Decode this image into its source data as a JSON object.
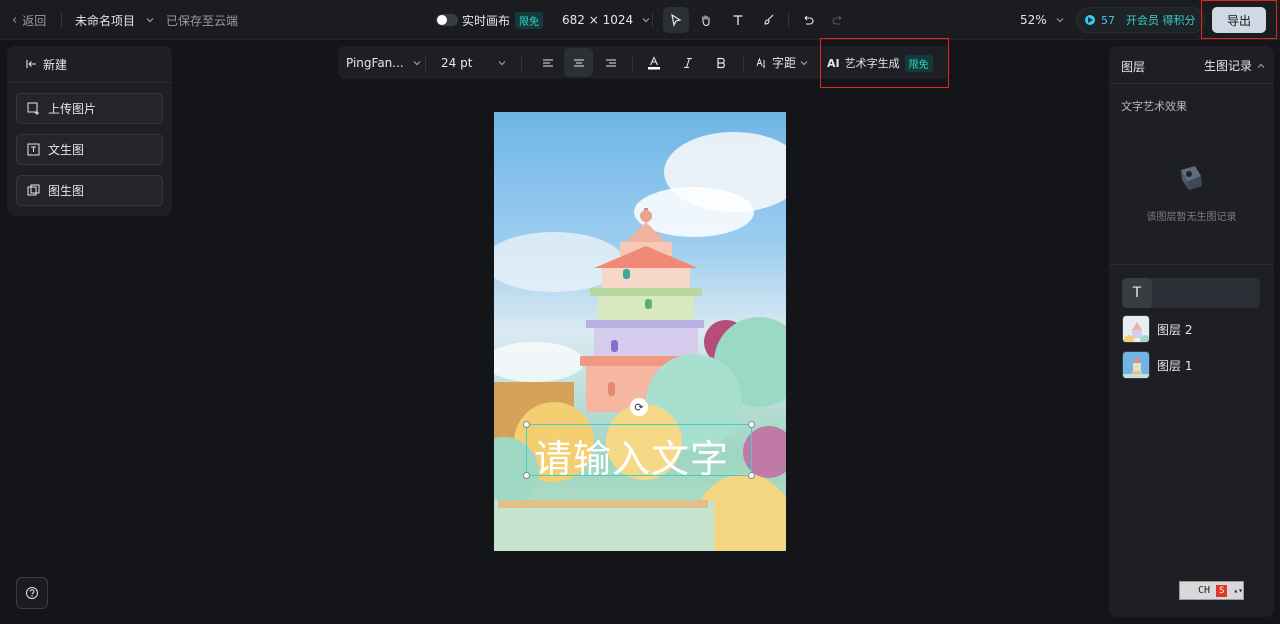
{
  "topbar": {
    "back_label": "返回",
    "project_name": "未命名项目",
    "save_status": "已保存至云端",
    "realtime_label": "实时画布",
    "realtime_badge": "限免",
    "canvas_size": "682 × 1024",
    "zoom": "52%",
    "credits_value": "57",
    "membership_label": "开会员 得积分",
    "export_label": "导出"
  },
  "left_panel": {
    "new_label": "新建",
    "buttons": [
      {
        "label": "上传图片",
        "icon": "upload-image-icon"
      },
      {
        "label": "文生图",
        "icon": "text-to-image-icon"
      },
      {
        "label": "图生图",
        "icon": "image-to-image-icon"
      }
    ]
  },
  "format_bar": {
    "font_family": "PingFan...",
    "font_size": "24 pt",
    "spacing_label": "字距",
    "ai_prefix": "AI",
    "ai_label": "艺术字生成",
    "ai_badge": "限免"
  },
  "canvas": {
    "placeholder_text": "请输入文字"
  },
  "right_panel": {
    "tab_layers": "图层",
    "tab_history": "生图记录",
    "section_title": "文字艺术效果",
    "empty_text": "该图层暂无生图记录",
    "layers": [
      {
        "label": "图层 2"
      },
      {
        "label": "图层 1"
      }
    ]
  },
  "ime": {
    "lang": "CH",
    "logo": "S"
  },
  "colors": {
    "accent": "#36d1c8",
    "highlight_border": "#e0271e",
    "background": "#141519",
    "panel": "#1e1f24"
  }
}
